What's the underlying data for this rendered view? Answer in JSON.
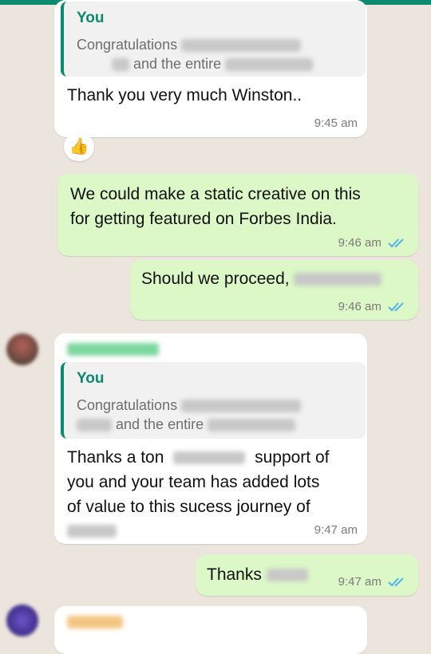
{
  "colors": {
    "background": "#ECE5DD",
    "incoming_bubble": "#FFFFFF",
    "outgoing_bubble": "#DCF8C6",
    "accent": "#0B8A6F",
    "read_ticks": "#4FB6EC"
  },
  "messages": [
    {
      "direction": "in",
      "quote": {
        "author": "You",
        "line1": "Congratulations",
        "line2": "and the entire"
      },
      "text": "Thank you very much Winston..",
      "time": "9:45 am",
      "reaction": "👍"
    },
    {
      "direction": "out",
      "text": "We could make a static creative on this for getting featured on Forbes India.",
      "text_line1": "We could make a static creative on this",
      "text_line2": "for getting featured on Forbes India.",
      "time": "9:46 am",
      "status": "read"
    },
    {
      "direction": "out",
      "text": "Should we proceed,",
      "time": "9:46 am",
      "status": "read"
    },
    {
      "direction": "in",
      "quote": {
        "author": "You",
        "line1": "Congratulations",
        "line2": "and the entire"
      },
      "text_line1": "Thanks a ton",
      "text_line1b": "support of",
      "text_line2": "you and your team has added lots",
      "text_line3": "of value to this sucess journey of",
      "time": "9:47 am"
    },
    {
      "direction": "out",
      "text": "Thanks",
      "time": "9:47 am",
      "status": "read"
    }
  ]
}
